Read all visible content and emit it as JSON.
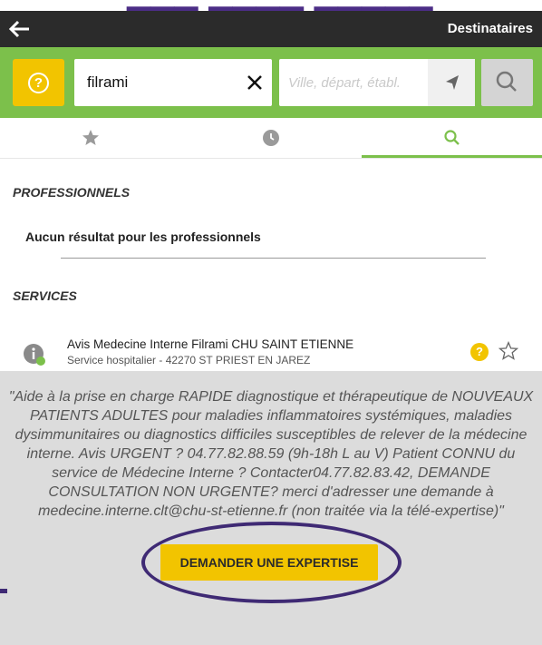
{
  "header": {
    "back_icon": "arrow-left-icon",
    "title": "Destinataires"
  },
  "search": {
    "help_icon": "question-circle-icon",
    "query": "filrami",
    "clear_icon": "close-icon",
    "location_placeholder": "Ville, départ, établ.",
    "geo_icon": "location-arrow-icon",
    "search_icon": "search-icon"
  },
  "tabs": [
    {
      "name": "favorites",
      "icon": "star-icon",
      "active": false
    },
    {
      "name": "history",
      "icon": "clock-icon",
      "active": false
    },
    {
      "name": "search",
      "icon": "search-icon",
      "active": true
    }
  ],
  "professionals": {
    "title": "PROFESSIONNELS",
    "empty_message": "Aucun résultat pour les professionnels"
  },
  "services": {
    "title": "SERVICES",
    "results": [
      {
        "name": "Avis Medecine Interne Filrami CHU SAINT ETIENNE",
        "subtitle": "Service hospitalier - 42270 ST PRIEST EN JAREZ",
        "description": "\"Aide à la prise en charge RAPIDE diagnostique et thérapeutique de NOUVEAUX PATIENTS ADULTES pour maladies inflammatoires systémiques, maladies dysimmunitaires ou diagnostics difficiles susceptibles de relever de la médecine interne. Avis URGENT ? 04.77.82.88.59 (9h-18h L au V) Patient CONNU du service de Médecine Interne ? Contacter04.77.82.83.42, DEMANDE CONSULTATION NON URGENTE? merci d'adresser une demande à medecine.interne.clt@chu-st-etienne.fr (non traitée via la télé-expertise)\"",
        "action_label": "DEMANDER UNE EXPERTISE"
      }
    ]
  },
  "colors": {
    "green_accent": "#7cc04b",
    "yellow_accent": "#f2c400",
    "header_bg": "#2b2b2b",
    "annotation": "#3f2a74"
  }
}
